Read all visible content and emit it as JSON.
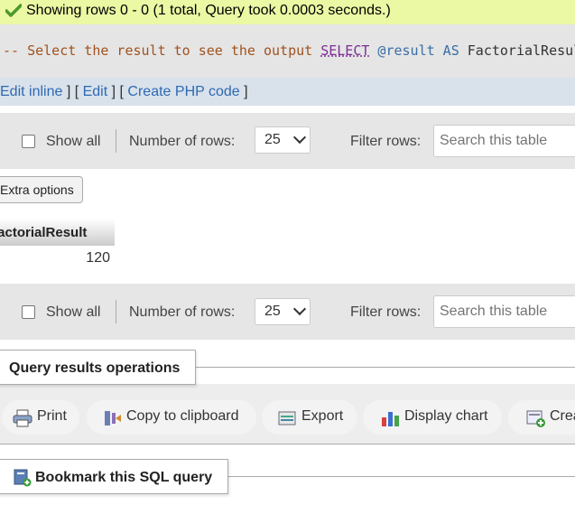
{
  "banner": {
    "text": "Showing rows 0 - 0 (1 total, Query took 0.0003 seconds.)",
    "icon": "checkmark-icon"
  },
  "sql": {
    "comment": "-- Select the result to see the output",
    "keyword_select": "SELECT",
    "variable": "@result",
    "keyword_as": "AS",
    "alias": "FactorialResul"
  },
  "edit_links": {
    "edit_inline": "Edit inline",
    "sep1": " ] [ ",
    "edit": "Edit",
    "sep2": " ] [ ",
    "create_php": "Create PHP code",
    "close": " ]"
  },
  "navbar_top": {
    "show_all": "Show all",
    "rows_label": "Number of rows:",
    "rows_value": "25",
    "filter_label": "Filter rows:",
    "search_placeholder": "Search this table"
  },
  "navbar_bottom": {
    "show_all": "Show all",
    "rows_label": "Number of rows:",
    "rows_value": "25",
    "filter_label": "Filter rows:",
    "search_placeholder": "Search this table"
  },
  "extra_options": "Extra options",
  "table": {
    "column": "FactorialResult",
    "rows": [
      [
        "120"
      ]
    ]
  },
  "operations": {
    "legend": "Query results operations",
    "print": "Print",
    "copy": "Copy to clipboard",
    "export": "Export",
    "display_chart": "Display chart",
    "create_view": "Crea"
  },
  "bookmark": {
    "legend": "Bookmark this SQL query"
  },
  "colors": {
    "banner_bg": "#ebf8a4",
    "link": "#2d6ab3",
    "sql_comment": "#a0521f",
    "sql_keyword": "#7f2e97"
  }
}
